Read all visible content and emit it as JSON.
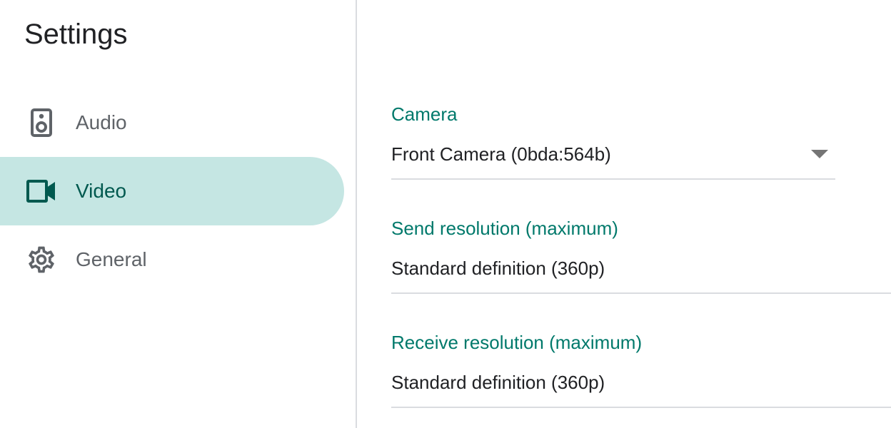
{
  "page_title": "Settings",
  "nav": {
    "items": [
      {
        "label": "Audio",
        "icon": "speaker-icon",
        "active": false
      },
      {
        "label": "Video",
        "icon": "videocam-icon",
        "active": true
      },
      {
        "label": "General",
        "icon": "gear-icon",
        "active": false
      }
    ]
  },
  "video": {
    "camera": {
      "label": "Camera",
      "value": "Front Camera (0bda:564b)"
    },
    "send_resolution": {
      "label": "Send resolution (maximum)",
      "value": "Standard definition (360p)"
    },
    "receive_resolution": {
      "label": "Receive resolution (maximum)",
      "value": "Standard definition (360p)"
    }
  },
  "colors": {
    "accent": "#00796b",
    "active_bg": "#c5e6e3",
    "active_text": "#00594f",
    "icon_gray": "#5f6368",
    "divider": "#dadce0"
  }
}
